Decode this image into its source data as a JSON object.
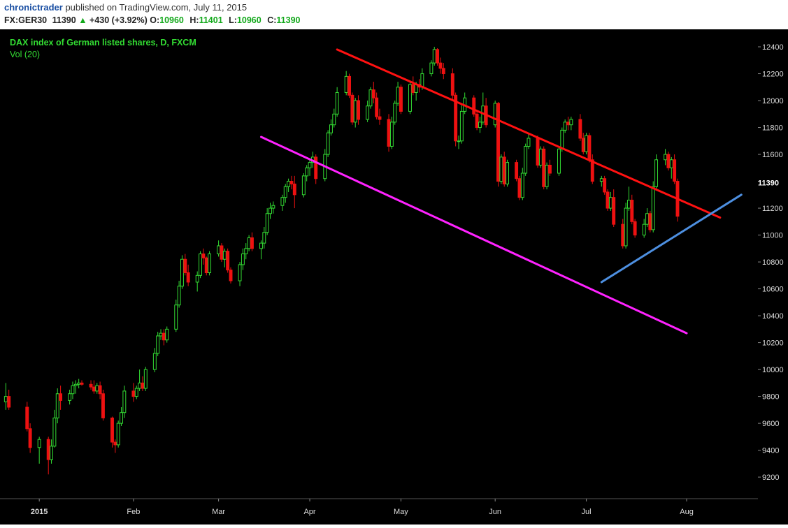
{
  "header": {
    "author": "chronictrader",
    "published_text": "published on TradingView.com, July 11, 2015",
    "symbol": "FX:GER30",
    "last": "11390",
    "change_icon": "triangle-up-icon",
    "change": "+430 (+3.92%)",
    "open_label": "O:",
    "open": "10960",
    "high_label": "H:",
    "high": "11401",
    "low_label": "L:",
    "low": "10960",
    "close_label": "C:",
    "close": "11390"
  },
  "legend": {
    "title": "DAX index of German listed shares, D, FXCM",
    "volume": "Vol (20)"
  },
  "colors": {
    "background": "#000000",
    "up": "#33dd33",
    "down": "#ee1111",
    "axis_text": "#dddddd",
    "channel_top": "#ff1111",
    "channel_bottom": "#ff22ff",
    "support": "#4d8fe0",
    "legend_text": "#33dd33"
  },
  "chart_data": {
    "type": "candlestick",
    "ylim": [
      9050,
      12530
    ],
    "y_ticks": [
      9200,
      9400,
      9600,
      9800,
      10000,
      10200,
      10400,
      10600,
      10800,
      11000,
      11200,
      11400,
      11600,
      11800,
      12000,
      12200,
      12400
    ],
    "y_tick_labels": [
      "9200",
      "9400",
      "9600",
      "9800",
      "10000",
      "10200",
      "10400",
      "10600",
      "10800",
      "11000",
      "11200",
      "",
      "11600",
      "11800",
      "12000",
      "12200",
      "12400"
    ],
    "last_price_label": "11390",
    "last_price": 11390,
    "x_labels": [
      {
        "label": "2015",
        "date": "2015-01-02",
        "bold": true
      },
      {
        "label": "Feb",
        "date": "2015-02-02",
        "bold": false
      },
      {
        "label": "Mar",
        "date": "2015-03-02",
        "bold": false
      },
      {
        "label": "Apr",
        "date": "2015-04-01",
        "bold": false
      },
      {
        "label": "May",
        "date": "2015-05-01",
        "bold": false
      },
      {
        "label": "Jun",
        "date": "2015-06-01",
        "bold": false
      },
      {
        "label": "Jul",
        "date": "2015-07-01",
        "bold": false
      },
      {
        "label": "Aug",
        "date": "2015-08-03",
        "bold": false
      }
    ],
    "date_range": [
      "2014-12-21",
      "2015-08-26"
    ],
    "trendlines": [
      {
        "name": "channel-top",
        "from": [
          "2015-04-10",
          12380
        ],
        "to": [
          "2015-08-14",
          11130
        ],
        "color": "#ff1111"
      },
      {
        "name": "channel-bottom",
        "from": [
          "2015-03-16",
          11730
        ],
        "to": [
          "2015-08-03",
          10270
        ],
        "color": "#ff22ff"
      },
      {
        "name": "support",
        "from": [
          "2015-07-06",
          10650
        ],
        "to": [
          "2015-08-21",
          11300
        ],
        "color": "#4d8fe0"
      }
    ],
    "candles": [
      [
        "2014-12-22",
        9760,
        9900,
        9700,
        9800
      ],
      [
        "2014-12-23",
        9800,
        9850,
        9700,
        9720
      ],
      [
        "2014-12-29",
        9720,
        9760,
        9540,
        9560
      ],
      [
        "2014-12-30",
        9560,
        9600,
        9380,
        9420
      ],
      [
        "2015-01-02",
        9420,
        9500,
        9300,
        9480
      ],
      [
        "2015-01-05",
        9480,
        9500,
        9220,
        9330
      ],
      [
        "2015-01-06",
        9330,
        9480,
        9300,
        9430
      ],
      [
        "2015-01-07",
        9430,
        9700,
        9420,
        9640
      ],
      [
        "2015-01-08",
        9640,
        9860,
        9600,
        9820
      ],
      [
        "2015-01-09",
        9820,
        9880,
        9700,
        9770
      ],
      [
        "2015-01-12",
        9770,
        9850,
        9740,
        9820
      ],
      [
        "2015-01-13",
        9820,
        9910,
        9780,
        9880
      ],
      [
        "2015-01-14",
        9880,
        9920,
        9820,
        9890
      ],
      [
        "2015-01-15",
        9890,
        9930,
        9860,
        9900
      ],
      [
        "2015-01-16",
        9900,
        9920,
        9880,
        9890
      ],
      [
        "2015-01-19",
        9890,
        9920,
        9850,
        9870
      ],
      [
        "2015-01-20",
        9870,
        9920,
        9820,
        9840
      ],
      [
        "2015-01-21",
        9840,
        9900,
        9820,
        9880
      ],
      [
        "2015-01-22",
        9880,
        9910,
        9780,
        9820
      ],
      [
        "2015-01-23",
        9820,
        9850,
        9620,
        9640
      ],
      [
        "2015-01-26",
        9640,
        9650,
        9420,
        9460
      ],
      [
        "2015-01-27",
        9460,
        9480,
        9380,
        9440
      ],
      [
        "2015-01-28",
        9440,
        9620,
        9420,
        9600
      ],
      [
        "2015-01-29",
        9600,
        9720,
        9580,
        9680
      ],
      [
        "2015-01-30",
        9680,
        9880,
        9640,
        9840
      ],
      [
        "2015-02-02",
        9840,
        9900,
        9760,
        9800
      ],
      [
        "2015-02-03",
        9800,
        9880,
        9780,
        9860
      ],
      [
        "2015-02-04",
        9860,
        10000,
        9840,
        9900
      ],
      [
        "2015-02-05",
        9900,
        9950,
        9840,
        9860
      ],
      [
        "2015-02-06",
        9860,
        10020,
        9840,
        10000
      ],
      [
        "2015-02-09",
        10000,
        10160,
        9980,
        10120
      ],
      [
        "2015-02-10",
        10120,
        10280,
        10100,
        10250
      ],
      [
        "2015-02-11",
        10250,
        10300,
        10220,
        10270
      ],
      [
        "2015-02-12",
        10270,
        10300,
        10180,
        10220
      ],
      [
        "2015-02-13",
        10220,
        10320,
        10200,
        10300
      ],
      [
        "2015-02-16",
        10300,
        10520,
        10280,
        10480
      ],
      [
        "2015-02-17",
        10480,
        10660,
        10460,
        10620
      ],
      [
        "2015-02-18",
        10620,
        10850,
        10600,
        10820
      ],
      [
        "2015-02-19",
        10820,
        10860,
        10700,
        10720
      ],
      [
        "2015-02-20",
        10720,
        10780,
        10620,
        10650
      ],
      [
        "2015-02-23",
        10650,
        10730,
        10580,
        10700
      ],
      [
        "2015-02-24",
        10700,
        10880,
        10680,
        10860
      ],
      [
        "2015-02-25",
        10860,
        10900,
        10780,
        10830
      ],
      [
        "2015-02-26",
        10830,
        10840,
        10700,
        10720
      ],
      [
        "2015-02-27",
        10720,
        10880,
        10700,
        10860
      ],
      [
        "2015-03-02",
        10860,
        10960,
        10840,
        10920
      ],
      [
        "2015-03-03",
        10920,
        10940,
        10800,
        10820
      ],
      [
        "2015-03-04",
        10820,
        10900,
        10760,
        10880
      ],
      [
        "2015-03-05",
        10880,
        10900,
        10720,
        10740
      ],
      [
        "2015-03-06",
        10740,
        10760,
        10640,
        10660
      ],
      [
        "2015-03-09",
        10660,
        10800,
        10620,
        10780
      ],
      [
        "2015-03-10",
        10780,
        10900,
        10740,
        10860
      ],
      [
        "2015-03-11",
        10860,
        10940,
        10820,
        10900
      ],
      [
        "2015-03-12",
        10900,
        11000,
        10880,
        10980
      ],
      [
        "2015-03-13",
        10980,
        11020,
        10880,
        10900
      ],
      [
        "2015-03-16",
        10900,
        10960,
        10820,
        10940
      ],
      [
        "2015-03-17",
        10940,
        11060,
        10900,
        11020
      ],
      [
        "2015-03-18",
        11020,
        11200,
        11000,
        11160
      ],
      [
        "2015-03-19",
        11160,
        11240,
        11120,
        11200
      ],
      [
        "2015-03-20",
        11200,
        11250,
        11160,
        11220
      ],
      [
        "2015-03-23",
        11220,
        11300,
        11180,
        11280
      ],
      [
        "2015-03-24",
        11280,
        11380,
        11240,
        11360
      ],
      [
        "2015-03-25",
        11360,
        11420,
        11320,
        11400
      ],
      [
        "2015-03-26",
        11400,
        11440,
        11340,
        11380
      ],
      [
        "2015-03-27",
        11380,
        11440,
        11200,
        11300
      ],
      [
        "2015-03-30",
        11300,
        11460,
        11280,
        11440
      ],
      [
        "2015-03-31",
        11440,
        11520,
        11400,
        11500
      ],
      [
        "2015-04-01",
        11500,
        11560,
        11440,
        11540
      ],
      [
        "2015-04-02",
        11540,
        11620,
        11500,
        11580
      ],
      [
        "2015-04-03",
        11580,
        11600,
        11380,
        11420
      ],
      [
        "2015-04-06",
        11420,
        11640,
        11400,
        11600
      ],
      [
        "2015-04-07",
        11600,
        11780,
        11580,
        11760
      ],
      [
        "2015-04-08",
        11760,
        11860,
        11740,
        11820
      ],
      [
        "2015-04-09",
        11820,
        11940,
        11800,
        11900
      ],
      [
        "2015-04-10",
        11900,
        12100,
        11880,
        12060
      ],
      [
        "2015-04-13",
        12060,
        12220,
        12040,
        12180
      ],
      [
        "2015-04-14",
        12180,
        12200,
        12020,
        12040
      ],
      [
        "2015-04-15",
        12040,
        12060,
        11820,
        11840
      ],
      [
        "2015-04-16",
        11840,
        12020,
        11800,
        12000
      ],
      [
        "2015-04-17",
        12000,
        12040,
        11820,
        11860
      ],
      [
        "2015-04-20",
        11860,
        12000,
        11840,
        11960
      ],
      [
        "2015-04-21",
        11960,
        12100,
        11940,
        12080
      ],
      [
        "2015-04-22",
        12080,
        12140,
        11980,
        12020
      ],
      [
        "2015-04-23",
        12020,
        12060,
        11860,
        11880
      ],
      [
        "2015-04-24",
        11880,
        11940,
        11820,
        11860
      ],
      [
        "2015-04-27",
        11860,
        11900,
        11620,
        11660
      ],
      [
        "2015-04-28",
        11660,
        11880,
        11640,
        11840
      ],
      [
        "2015-04-29",
        11840,
        12000,
        11820,
        11980
      ],
      [
        "2015-04-30",
        11980,
        12140,
        11960,
        12100
      ],
      [
        "2015-05-01",
        12100,
        12120,
        11900,
        11920
      ],
      [
        "2015-05-04",
        11920,
        12140,
        11900,
        12120
      ],
      [
        "2015-05-05",
        12120,
        12180,
        12040,
        12060
      ],
      [
        "2015-05-06",
        12060,
        12140,
        12000,
        12120
      ],
      [
        "2015-05-07",
        12120,
        12160,
        12060,
        12100
      ],
      [
        "2015-05-08",
        12100,
        12240,
        12080,
        12200
      ],
      [
        "2015-05-11",
        12200,
        12300,
        12180,
        12280
      ],
      [
        "2015-05-12",
        12280,
        12400,
        12260,
        12380
      ],
      [
        "2015-05-13",
        12380,
        12390,
        12260,
        12280
      ],
      [
        "2015-05-14",
        12280,
        12320,
        12200,
        12240
      ],
      [
        "2015-05-15",
        12240,
        12280,
        12160,
        12200
      ],
      [
        "2015-05-18",
        12200,
        12240,
        12000,
        12040
      ],
      [
        "2015-05-19",
        12040,
        12060,
        11660,
        11700
      ],
      [
        "2015-05-20",
        11700,
        11740,
        11640,
        11700
      ],
      [
        "2015-05-21",
        11700,
        11980,
        11680,
        11920
      ],
      [
        "2015-05-22",
        11920,
        12060,
        11900,
        12020
      ],
      [
        "2015-05-25",
        12020,
        12040,
        11880,
        11900
      ],
      [
        "2015-05-26",
        11900,
        11920,
        11780,
        11800
      ],
      [
        "2015-05-27",
        11800,
        11880,
        11760,
        11840
      ],
      [
        "2015-05-28",
        11840,
        12060,
        11820,
        11960
      ],
      [
        "2015-05-29",
        11960,
        12020,
        11800,
        11820
      ],
      [
        "2015-06-01",
        11820,
        12000,
        11800,
        11980
      ],
      [
        "2015-06-02",
        11980,
        11990,
        11360,
        11400
      ],
      [
        "2015-06-03",
        11400,
        11600,
        11380,
        11580
      ],
      [
        "2015-06-04",
        11580,
        11620,
        11360,
        11380
      ],
      [
        "2015-06-05",
        11380,
        11560,
        11360,
        11540
      ],
      [
        "2015-06-08",
        11540,
        11560,
        11400,
        11420
      ],
      [
        "2015-06-09",
        11420,
        11440,
        11260,
        11280
      ],
      [
        "2015-06-10",
        11280,
        11500,
        11260,
        11460
      ],
      [
        "2015-06-11",
        11460,
        11680,
        11440,
        11660
      ],
      [
        "2015-06-12",
        11660,
        11760,
        11640,
        11720
      ],
      [
        "2015-06-15",
        11720,
        11740,
        11500,
        11520
      ],
      [
        "2015-06-16",
        11520,
        11660,
        11500,
        11640
      ],
      [
        "2015-06-17",
        11640,
        11660,
        11340,
        11360
      ],
      [
        "2015-06-18",
        11360,
        11540,
        11340,
        11520
      ],
      [
        "2015-06-19",
        11520,
        11560,
        11440,
        11460
      ],
      [
        "2015-06-22",
        11460,
        11660,
        11440,
        11640
      ],
      [
        "2015-06-23",
        11640,
        11800,
        11620,
        11780
      ],
      [
        "2015-06-24",
        11780,
        11860,
        11760,
        11840
      ],
      [
        "2015-06-25",
        11840,
        11880,
        11780,
        11820
      ],
      [
        "2015-06-26",
        11820,
        11880,
        11780,
        11860
      ],
      [
        "2015-06-29",
        11860,
        11900,
        11700,
        11720
      ],
      [
        "2015-06-30",
        11720,
        11760,
        11600,
        11620
      ],
      [
        "2015-07-01",
        11620,
        11760,
        11600,
        11740
      ],
      [
        "2015-07-02",
        11740,
        11760,
        11540,
        11560
      ],
      [
        "2015-07-03",
        11560,
        11600,
        11380,
        11400
      ],
      [
        "2015-07-06",
        11400,
        11440,
        11360,
        11420
      ],
      [
        "2015-07-07",
        11420,
        11440,
        11300,
        11320
      ],
      [
        "2015-07-08",
        11320,
        11340,
        11180,
        11200
      ],
      [
        "2015-07-09",
        11200,
        11320,
        11180,
        11280
      ],
      [
        "2015-07-10",
        11280,
        11340,
        11060,
        11080
      ],
      [
        "2015-07-13",
        11080,
        11120,
        10900,
        10920
      ],
      [
        "2015-07-14",
        10920,
        11240,
        10900,
        11200
      ],
      [
        "2015-07-15",
        11200,
        11360,
        11180,
        11260
      ],
      [
        "2015-07-16",
        11260,
        11300,
        11080,
        11100
      ],
      [
        "2015-07-17",
        11100,
        11120,
        10980,
        11000
      ],
      [
        "2015-07-20",
        11000,
        11120,
        10980,
        11080
      ],
      [
        "2015-07-21",
        11080,
        11200,
        11060,
        11160
      ],
      [
        "2015-07-22",
        11160,
        11180,
        11020,
        11040
      ],
      [
        "2015-07-23",
        11040,
        11400,
        11020,
        11360
      ],
      [
        "2015-07-24",
        11360,
        11600,
        11340,
        11560
      ],
      [
        "2015-07-27",
        11560,
        11640,
        11520,
        11600
      ],
      [
        "2015-07-28",
        11600,
        11620,
        11480,
        11500
      ],
      [
        "2015-07-29",
        11500,
        11580,
        11420,
        11560
      ],
      [
        "2015-07-30",
        11560,
        11600,
        11380,
        11400
      ],
      [
        "2015-07-31",
        11400,
        11420,
        11100,
        11140
      ]
    ]
  }
}
